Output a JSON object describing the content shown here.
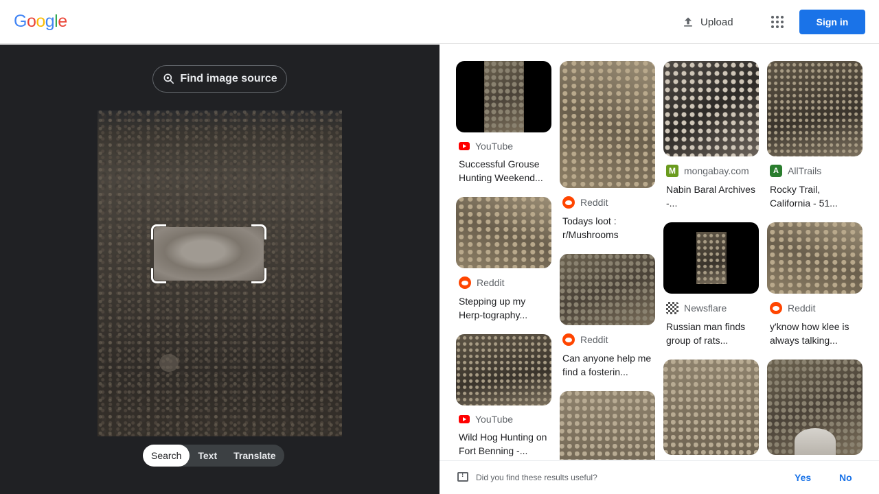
{
  "header": {
    "logo_letters": [
      {
        "ch": "G",
        "color": "#4285F4"
      },
      {
        "ch": "o",
        "color": "#EA4335"
      },
      {
        "ch": "o",
        "color": "#FBBC05"
      },
      {
        "ch": "g",
        "color": "#4285F4"
      },
      {
        "ch": "l",
        "color": "#34A853"
      },
      {
        "ch": "e",
        "color": "#EA4335"
      }
    ],
    "upload_label": "Upload",
    "signin_label": "Sign in"
  },
  "lens": {
    "find_source_label": "Find image source",
    "modes": [
      "Search",
      "Text",
      "Translate"
    ],
    "active_mode": "Search"
  },
  "results": {
    "col1": [
      {
        "source": "YouTube",
        "icon": "youtube-icon",
        "title": "Successful Grouse Hunting Weekend..."
      },
      {
        "source": "Reddit",
        "icon": "reddit-icon",
        "title": "Stepping up my Herp-tography..."
      },
      {
        "source": "YouTube",
        "icon": "youtube-icon",
        "title": "Wild Hog Hunting on Fort Benning -..."
      }
    ],
    "col2": [
      {
        "source": "Reddit",
        "icon": "reddit-icon",
        "title": "Todays loot : r/Mushrooms"
      },
      {
        "source": "Reddit",
        "icon": "reddit-icon",
        "title": "Can anyone help me find a fosterin..."
      }
    ],
    "col3": [
      {
        "source": "mongabay.com",
        "icon": "mongabay-icon",
        "title": "Nabin Baral Archives -..."
      },
      {
        "source": "Newsflare",
        "icon": "newsflare-icon",
        "title": "Russian man finds group of rats..."
      }
    ],
    "col4": [
      {
        "source": "AllTrails",
        "icon": "alltrails-icon",
        "title": "Rocky Trail, California - 51..."
      },
      {
        "source": "Reddit",
        "icon": "reddit-icon",
        "title": "y'know how klee is always talking..."
      }
    ]
  },
  "feedback": {
    "question": "Did you find these results useful?",
    "yes": "Yes",
    "no": "No"
  },
  "colors": {
    "accent": "#1a73e8",
    "dark_panel": "#202124"
  }
}
